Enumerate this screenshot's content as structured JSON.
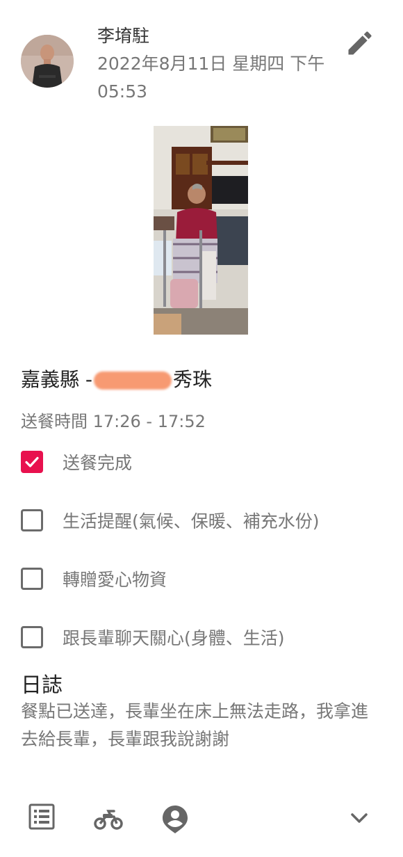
{
  "post": {
    "author": "李堉駐",
    "datetime": "2022年8月11日 星期四 下午05:53"
  },
  "recipient": {
    "prefix": "嘉義縣 -",
    "suffix": "秀珠"
  },
  "delivery_time": "送餐時間 17:26 - 17:52",
  "checklist": [
    {
      "label": "送餐完成",
      "checked": true
    },
    {
      "label": "生活提醒(氣候、保暖、補充水份)",
      "checked": false
    },
    {
      "label": "轉贈愛心物資",
      "checked": false
    },
    {
      "label": "跟長輩聊天關心(身體、生活)",
      "checked": false
    }
  ],
  "log": {
    "title": "日誌",
    "body": "餐點已送達，長輩坐在床上無法走路，我拿進去給長輩，長輩跟我說謝謝"
  },
  "colors": {
    "accent": "#e8114e",
    "icon_gray": "#666666"
  },
  "icons": [
    "edit-icon",
    "list-icon",
    "motorcycle-icon",
    "location-person-icon",
    "chevron-down-icon"
  ]
}
